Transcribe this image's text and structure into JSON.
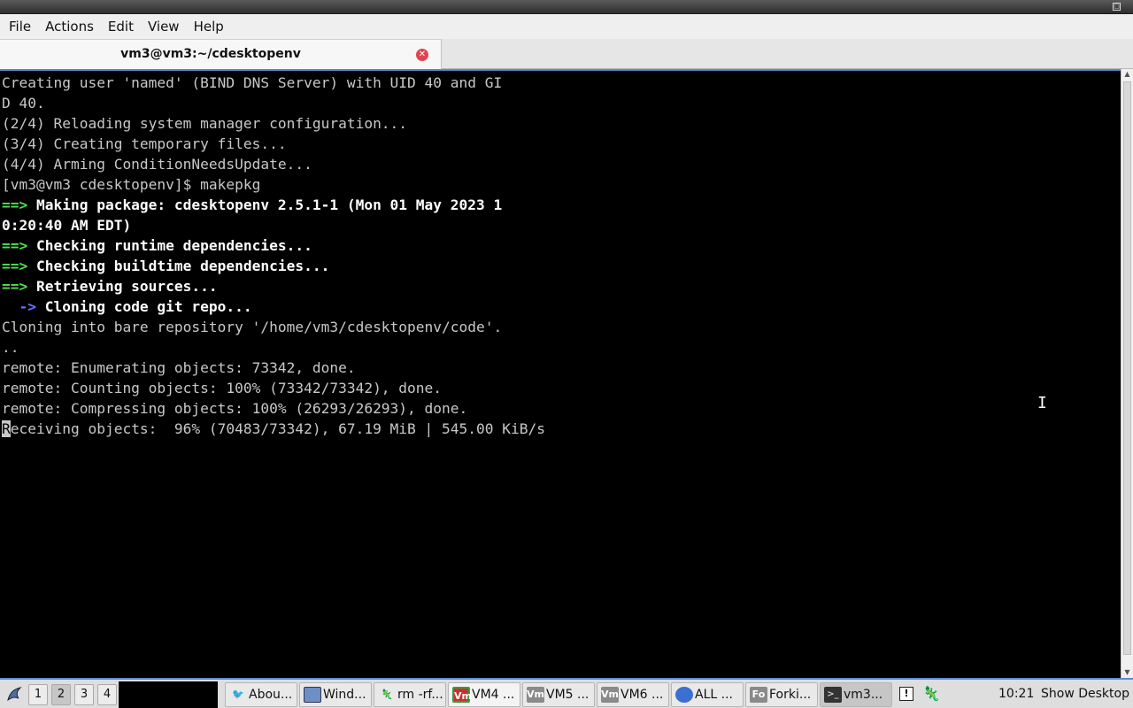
{
  "window": {
    "title": ""
  },
  "menubar": {
    "items": [
      "File",
      "Actions",
      "Edit",
      "View",
      "Help"
    ]
  },
  "tab": {
    "title": "vm3@vm3:~/cdesktopenv",
    "close_icon": "close-icon"
  },
  "terminal": {
    "lines": [
      {
        "text": "Creating user 'named' (BIND DNS Server) with UID 40 and GI",
        "style": "normal"
      },
      {
        "text": "D 40.",
        "style": "normal"
      },
      {
        "text": "(2/4) Reloading system manager configuration...",
        "style": "normal"
      },
      {
        "text": "(3/4) Creating temporary files...",
        "style": "normal"
      },
      {
        "text": "(4/4) Arming ConditionNeedsUpdate...",
        "style": "normal"
      },
      {
        "text": "[vm3@vm3 cdesktopenv]$ makepkg",
        "style": "normal"
      },
      {
        "prefix": "==> ",
        "text": "Making package: cdesktopenv 2.5.1-1 (Mon 01 May 2023 1",
        "style": "bold-green"
      },
      {
        "text": "0:20:40 AM EDT)",
        "style": "bold"
      },
      {
        "prefix": "==> ",
        "text": "Checking runtime dependencies...",
        "style": "bold-green"
      },
      {
        "prefix": "==> ",
        "text": "Checking buildtime dependencies...",
        "style": "bold-green"
      },
      {
        "prefix": "==> ",
        "text": "Retrieving sources...",
        "style": "bold-green"
      },
      {
        "prefix": "  -> ",
        "text": "Cloning code git repo...",
        "style": "bold-blue"
      },
      {
        "text": "Cloning into bare repository '/home/vm3/cdesktopenv/code'.",
        "style": "normal"
      },
      {
        "text": "..",
        "style": "normal"
      },
      {
        "text": "remote: Enumerating objects: 73342, done.",
        "style": "normal"
      },
      {
        "text": "remote: Counting objects: 100% (73342/73342), done.",
        "style": "normal"
      },
      {
        "text": "remote: Compressing objects: 100% (26293/26293), done.",
        "style": "normal"
      },
      {
        "cursor_char": "R",
        "text": "eceiving objects:  96% (70483/73342), 67.19 MiB | 545.00 KiB/s",
        "style": "cursor"
      }
    ]
  },
  "taskbar": {
    "workspaces": [
      "1",
      "2",
      "3",
      "4"
    ],
    "active_workspace": "2",
    "tasks": [
      {
        "label": "Abou...",
        "icon": "bird-icon"
      },
      {
        "label": "Wind...",
        "icon": "window-icon"
      },
      {
        "label": "rm -rf...",
        "icon": "chameleon-icon"
      },
      {
        "label": "VM4 ...",
        "icon": "vm-icon",
        "icon_text": "Vm"
      },
      {
        "label": "VM5 ...",
        "icon": "vm-icon",
        "icon_text": "Vm"
      },
      {
        "label": "VM6 ...",
        "icon": "vm-icon",
        "icon_text": "Vm"
      },
      {
        "label": "ALL ...",
        "icon": "network-icon"
      },
      {
        "label": "Forki...",
        "icon": "fo-icon",
        "icon_text": "Fo"
      },
      {
        "label": "vm3...",
        "icon": "terminal-icon"
      }
    ],
    "clock": "10:21",
    "show_desktop": "Show Desktop"
  }
}
